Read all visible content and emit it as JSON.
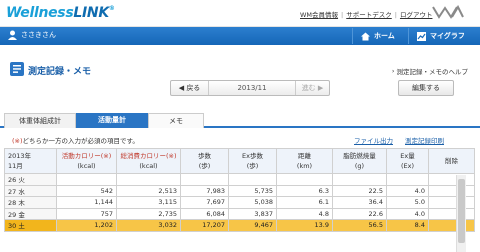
{
  "header": {
    "logo_part1": "Wellness",
    "logo_part2": "LINK",
    "links": [
      "WM会員情報",
      "サポートデスク",
      "ログアウト"
    ]
  },
  "navbar": {
    "user_name": "ささきさん",
    "home_label": "ホーム",
    "mygraph_label": "マイグラフ"
  },
  "page": {
    "title": "測定記録・メモ",
    "help_link": "測定記録・メモのヘルプ",
    "prev_label": "戻る",
    "current_period": "2013/11",
    "next_label": "進む",
    "edit_label": "編集する"
  },
  "tabs": [
    "体重体組成計",
    "活動量計",
    "メモ"
  ],
  "notice": {
    "mark": "(※)",
    "text": "どちらか一方の入力が必須の項目です。"
  },
  "actions": {
    "export": "ファイル出力",
    "print": "測定記録印刷"
  },
  "table": {
    "headers": [
      {
        "l1": "2013年",
        "l2": "11月"
      },
      {
        "l1": "活動カロリー(※)",
        "l2": "(kcal)"
      },
      {
        "l1": "総消費カロリー(※)",
        "l2": "(kcal)"
      },
      {
        "l1": "歩数",
        "l2": "(歩)"
      },
      {
        "l1": "Ex歩数",
        "l2": "(歩)"
      },
      {
        "l1": "距離",
        "l2": "(km)"
      },
      {
        "l1": "脂肪燃焼量",
        "l2": "(g)"
      },
      {
        "l1": "Ex量",
        "l2": "(Ex)"
      },
      {
        "l1": "削除",
        "l2": ""
      }
    ],
    "rows": [
      {
        "day": "26 火",
        "active": "",
        "total": "",
        "steps": "",
        "ex_steps": "",
        "distance": "",
        "fat": "",
        "ex": "",
        "today": false
      },
      {
        "day": "27 水",
        "active": "542",
        "total": "2,513",
        "steps": "7,983",
        "ex_steps": "5,735",
        "distance": "6.3",
        "fat": "22.5",
        "ex": "4.0",
        "today": false
      },
      {
        "day": "28 木",
        "active": "1,144",
        "total": "3,115",
        "steps": "7,697",
        "ex_steps": "5,038",
        "distance": "6.1",
        "fat": "36.4",
        "ex": "5.0",
        "today": false
      },
      {
        "day": "29 金",
        "active": "757",
        "total": "2,735",
        "steps": "6,084",
        "ex_steps": "3,837",
        "distance": "4.8",
        "fat": "22.6",
        "ex": "4.0",
        "today": false
      },
      {
        "day": "30 土",
        "active": "1,202",
        "total": "3,032",
        "steps": "17,207",
        "ex_steps": "9,467",
        "distance": "13.9",
        "fat": "56.5",
        "ex": "8.4",
        "today": true
      }
    ]
  },
  "colors": {
    "accent": "#2a75c4",
    "navbar": "#1a6dbd",
    "today_row": "#f7c547",
    "required_mark": "#c0392b"
  }
}
